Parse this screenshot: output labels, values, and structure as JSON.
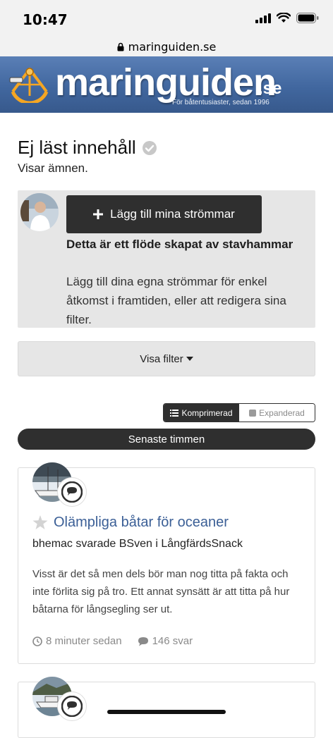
{
  "status_bar": {
    "time": "10:47"
  },
  "browser": {
    "url": "maringuiden.se"
  },
  "banner": {
    "name": "maringuiden",
    "tld": ".se",
    "tagline": "För båtentusiaster, sedan 1996"
  },
  "page": {
    "title": "Ej läst innehåll",
    "subtitle": "Visar ämnen."
  },
  "stream": {
    "button_label": "Lägg till mina strömmar",
    "heading": "Detta är ett flöde skapat av stavhammar",
    "description": "Lägg till dina egna strömmar för enkel åtkomst i framtiden, eller att redigera sina filter."
  },
  "filter": {
    "label": "Visa filter"
  },
  "view_toggle": {
    "options": [
      "Komprimerad",
      "Expanderad"
    ],
    "selected": "Komprimerad"
  },
  "time_group": {
    "label": "Senaste timmen"
  },
  "topics": [
    {
      "title": "Olämpliga båtar för oceaner",
      "meta": "bhemac svarade BSven i LångfärdsSnack",
      "snippet": "Visst är det så men dels bör man nog titta på fakta och inte förlita sig på tro. Ett annat synsätt är att titta på hur båtarna för långsegling ser ut.",
      "time_ago": "8 minuter sedan",
      "replies": "146 svar"
    }
  ],
  "colors": {
    "banner_blue": "#41679f",
    "link_blue": "#3b5f96",
    "dark": "#2f2f2f",
    "panel_gray": "#e6e6e6"
  }
}
